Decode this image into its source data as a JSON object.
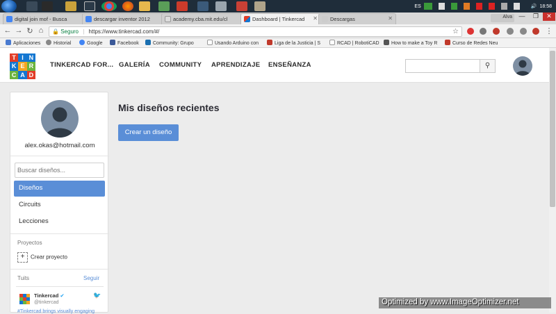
{
  "taskbar": {
    "language": "ES",
    "clock": "18:58"
  },
  "browser": {
    "tabs": [
      {
        "label": "digital join mof - Busca",
        "favicon": "google-icon"
      },
      {
        "label": "descargar inventor 2012",
        "favicon": "google-icon"
      },
      {
        "label": "academy.cba.mit.edu/cl",
        "favicon": "page-icon"
      },
      {
        "label": "Dashboard | Tinkercad",
        "favicon": "tinkercad-icon"
      },
      {
        "label": "Descargas",
        "favicon": "download-icon"
      }
    ],
    "profile_name": "Alva",
    "secure_label": "Seguro",
    "url": "https://www.tinkercad.com/#/",
    "bookmarks": [
      {
        "label": "Aplicaciones"
      },
      {
        "label": "Historial"
      },
      {
        "label": "Google"
      },
      {
        "label": "Facebook"
      },
      {
        "label": "Community: Grupo"
      },
      {
        "label": "Usando Arduino con"
      },
      {
        "label": "Liga de la Justicia | S"
      },
      {
        "label": "RCAD | RobotiCAD"
      },
      {
        "label": "How to make a Toy R"
      },
      {
        "label": "Curso de Redes Neu"
      }
    ]
  },
  "site": {
    "logo_letters": [
      "T",
      "I",
      "N",
      "K",
      "E",
      "R",
      "C",
      "A",
      "D"
    ],
    "nav": [
      "TINKERCAD FOR...",
      "GALERÍA",
      "COMMUNITY",
      "APRENDIZAJE",
      "ENSEÑANZA"
    ]
  },
  "sidebar": {
    "email": "alex.okas@hotmail.com",
    "search_placeholder": "Buscar diseños...",
    "items": [
      {
        "label": "Diseños",
        "active": true
      },
      {
        "label": "Circuits",
        "active": false
      },
      {
        "label": "Lecciones",
        "active": false
      }
    ],
    "projects_label": "Proyectos",
    "create_project": "Crear proyecto",
    "tweets_label": "Tuits",
    "follow": "Seguir",
    "tweet": {
      "name": "Tinkercad",
      "handle": "@tinkercad",
      "text": "#Tinkercad brings visually engaging"
    }
  },
  "main": {
    "heading": "Mis diseños recientes",
    "create_button": "Crear un diseño"
  },
  "watermark": "Optimized by www.ImageOptimizer.net",
  "colors": {
    "accent": "#5a8ed7",
    "logo_red": "#e23d28",
    "logo_blue": "#1477d1",
    "logo_orange": "#f5a623",
    "logo_green": "#6cb43f"
  }
}
